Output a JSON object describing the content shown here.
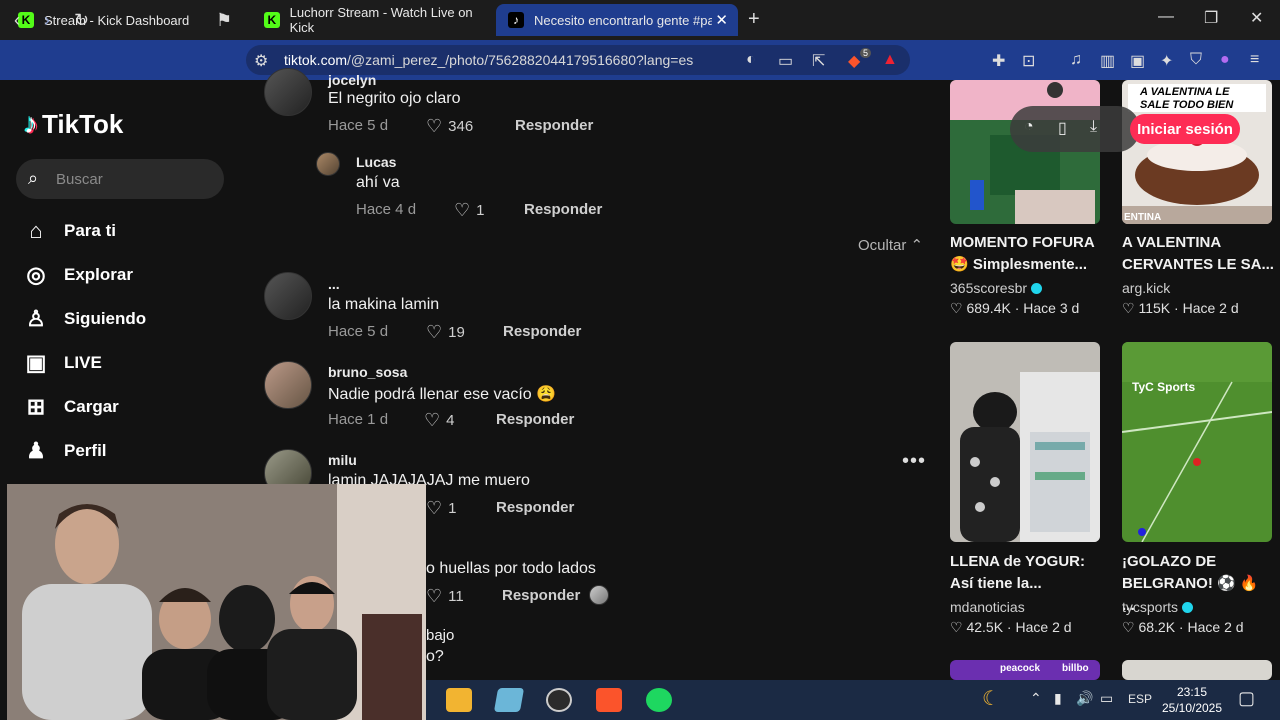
{
  "browser": {
    "tabs": [
      {
        "label": "Stream - Kick Dashboard",
        "active": false
      },
      {
        "label": "Luchorr Stream - Watch Live on Kick",
        "active": false
      },
      {
        "label": "Necesito encontrarlo gente #par",
        "active": true
      }
    ],
    "url_host": "tiktok.com",
    "url_path": "/@zami_perez_/photo/7562882044179516680?lang=es",
    "brave_badge": "5"
  },
  "tiktok": {
    "logo_text": "TikTok",
    "search_placeholder": "Buscar",
    "nav": [
      {
        "label": "Para ti",
        "icon": "home-icon"
      },
      {
        "label": "Explorar",
        "icon": "compass-icon"
      },
      {
        "label": "Siguiendo",
        "icon": "user-follow-icon"
      },
      {
        "label": "LIVE",
        "icon": "live-tv-icon"
      },
      {
        "label": "Cargar",
        "icon": "upload-icon"
      },
      {
        "label": "Perfil",
        "icon": "profile-icon"
      }
    ],
    "login_button": "Iniciar sesión",
    "hide_label": "Ocultar",
    "reply_label": "Responder"
  },
  "comments": [
    {
      "user": "jocelyn",
      "text": "El negrito ojo claro",
      "time": "Hace 5 d",
      "likes": "346"
    },
    {
      "user": "Lucas",
      "text": "ahí va",
      "time": "Hace 4 d",
      "likes": "1",
      "nested": true
    },
    {
      "user": "...",
      "text": "la makina lamin",
      "time": "Hace 5 d",
      "likes": "19"
    },
    {
      "user": "bruno_sosa",
      "text": "Nadie podrá llenar ese vacío 😩",
      "time": "Hace 1 d",
      "likes": "4"
    },
    {
      "user": "milu",
      "text": "lamin JAJAJAJAJ me muero",
      "likes": "1"
    },
    {
      "text": "o huellas por todo lados",
      "likes": "11"
    },
    {
      "text": "bajo"
    },
    {
      "text": "o?"
    }
  ],
  "videos": [
    {
      "title_l1": "MOMENTO FOFURA",
      "title_l2": "🤩 Simplesmente...",
      "author": "365scoresbr",
      "verified": true,
      "likes": "689.4K",
      "time": "Hace 3 d"
    },
    {
      "title_l1": "A VALENTINA",
      "title_l2": "CERVANTES LE SA...",
      "author": "arg.kick",
      "verified": false,
      "likes": "115K",
      "time": "Hace 2 d",
      "overlay_l1": "A VALENTINA LE",
      "overlay_l2": "SALE TODO BIEN",
      "overlay_l3": "ENTINA"
    },
    {
      "title_l1": "LLENA de YOGUR:",
      "title_l2": "Así tiene la...",
      "author": "mdanoticias",
      "verified": false,
      "likes": "42.5K",
      "time": "Hace 2 d"
    },
    {
      "title_l1": "¡GOLAZO DE",
      "title_l2": "BELGRANO! ⚽ 🔥 ...",
      "author": "tycsports",
      "verified": true,
      "likes": "68.2K",
      "time": "Hace 2 d",
      "overlay_l1": "TyC Sports"
    }
  ],
  "partial_thumbs": {
    "left": "peacock",
    "left2": "billbo"
  },
  "taskbar": {
    "lang": "ESP",
    "time": "23:15",
    "date": "25/10/2025"
  },
  "colors": {
    "accent": "#fe2c55",
    "browser_blue": "#1f3d8f",
    "verified": "#20d5ec"
  }
}
